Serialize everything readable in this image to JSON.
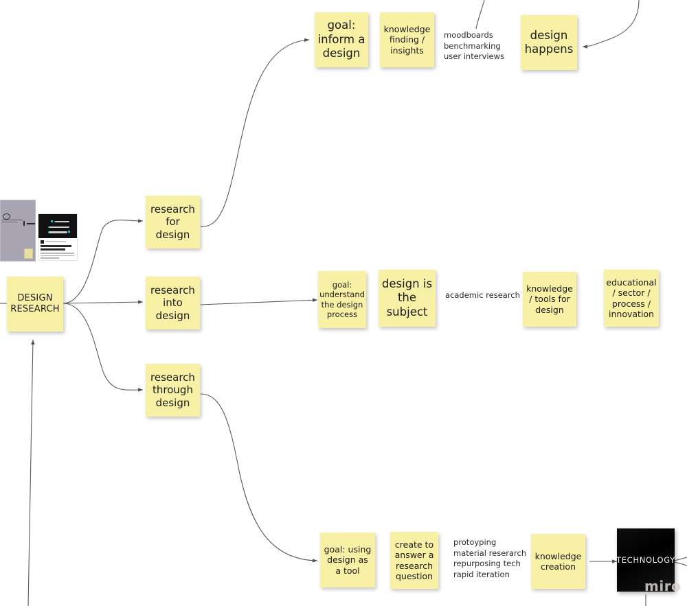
{
  "board": {
    "watermark": "miro",
    "accent_note_color": "#f7f0a5",
    "tech_card_color": "#000000",
    "connector_color": "#5a5a5a"
  },
  "thumbnails": {
    "doc_preview": "document-thumbnail",
    "link_card": {
      "title": "The Three Faces of\nDesign Research",
      "description": "The meanings of \"design research\"\nexplained: research for, into and\nthrough design."
    }
  },
  "root": {
    "label": "DESIGN\nRESEARCH"
  },
  "branches": [
    {
      "id": "for",
      "label": "research\nfor\ndesign"
    },
    {
      "id": "into",
      "label": "research\ninto\ndesign"
    },
    {
      "id": "through",
      "label": "research\nthrough\ndesign"
    }
  ],
  "row_for_design": {
    "goal": "goal:\ninform a\ndesign",
    "outcome": "knowledge\nfinding /\ninsights",
    "methods": "moodboards\nbenchmarking\nuser interviews",
    "result": "design\nhappens"
  },
  "row_into_design": {
    "goal": "goal:\nunderstand\nthe design\nprocess",
    "outcome": "design is\nthe\nsubject",
    "methods": "academic research",
    "knowledge": "knowledge\n/ tools for\ndesign",
    "domains": "educational\n/ sector /\nprocess /\ninnovation"
  },
  "row_through_design": {
    "goal": "goal: using\ndesign as\na tool",
    "outcome": "create to\nanswer a\nresearch\nquestion",
    "methods": "protoyping\nmaterial reserarch\nrepurposing tech\nrapid iteration",
    "knowledge": "knowledge\ncreation",
    "technology": "TECHNOLOGY"
  }
}
